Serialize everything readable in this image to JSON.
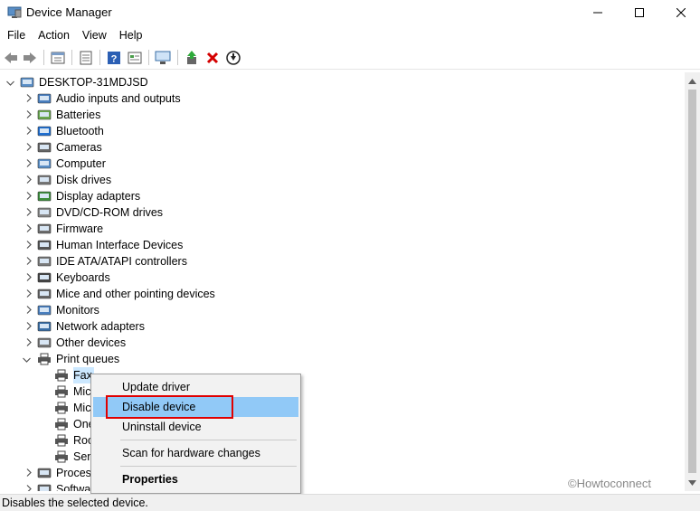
{
  "window": {
    "title": "Device Manager"
  },
  "menu": [
    "File",
    "Action",
    "View",
    "Help"
  ],
  "toolbar": {
    "buttons": [
      "back-icon",
      "forward-icon",
      "properties-icon",
      "list-icon",
      "help-icon",
      "details-icon",
      "computer-scan-icon",
      "update-driver-icon",
      "uninstall-icon",
      "disable-icon"
    ]
  },
  "tree": {
    "root": "DESKTOP-31MDJSD",
    "categories": [
      "Audio inputs and outputs",
      "Batteries",
      "Bluetooth",
      "Cameras",
      "Computer",
      "Disk drives",
      "Display adapters",
      "DVD/CD-ROM drives",
      "Firmware",
      "Human Interface Devices",
      "IDE ATA/ATAPI controllers",
      "Keyboards",
      "Mice and other pointing devices",
      "Monitors",
      "Network adapters",
      "Other devices",
      "Print queues"
    ],
    "print_queue_children": [
      "Fax",
      "Mic",
      "Mic",
      "One",
      "Roo",
      "Sen"
    ],
    "after": [
      "Process",
      "Softwa"
    ]
  },
  "context_menu": {
    "update": "Update driver",
    "disable": "Disable device",
    "uninstall": "Uninstall device",
    "scan": "Scan for hardware changes",
    "properties": "Properties"
  },
  "watermark": "©Howtoconnect",
  "status": "Disables the selected device."
}
